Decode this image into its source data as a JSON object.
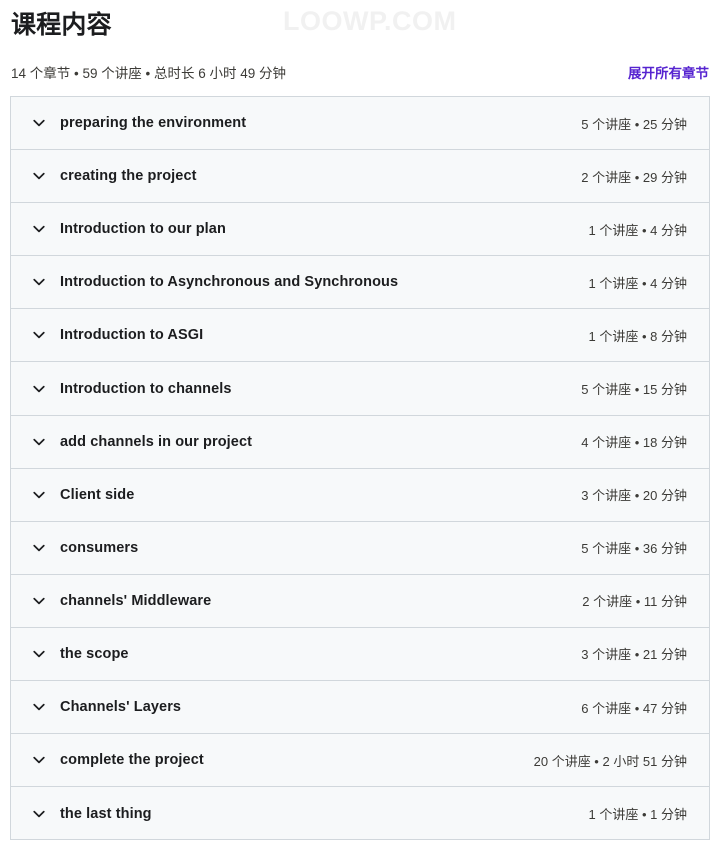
{
  "watermark": {
    "text": "LOOWP.COM"
  },
  "header": {
    "title": "课程内容",
    "summary": "14 个章节 • 59 个讲座 • 总时长 6 小时 49 分钟",
    "expand_all_label": "展开所有章节",
    "link_color": "#5624d0"
  },
  "colors": {
    "row_background": "#f7f9fa",
    "border": "#d1d7dc",
    "text_primary": "#1c1d1f",
    "text_secondary": "#3c3b37",
    "accent": "#5624d0",
    "watermark": "#f1f1f1"
  },
  "icons": {
    "chevron": "chevron-down-icon"
  },
  "sections": [
    {
      "title": "preparing the environment",
      "meta": "5 个讲座 • 25 分钟"
    },
    {
      "title": "creating the project",
      "meta": "2 个讲座 • 29 分钟"
    },
    {
      "title": "Introduction to our plan",
      "meta": "1 个讲座 • 4 分钟"
    },
    {
      "title": "Introduction to Asynchronous and Synchronous",
      "meta": "1 个讲座 • 4 分钟"
    },
    {
      "title": "Introduction to ASGI",
      "meta": "1 个讲座 • 8 分钟"
    },
    {
      "title": "Introduction to channels",
      "meta": "5 个讲座 • 15 分钟"
    },
    {
      "title": "add channels in our project",
      "meta": "4 个讲座 • 18 分钟"
    },
    {
      "title": "Client side",
      "meta": "3 个讲座 • 20 分钟"
    },
    {
      "title": "consumers",
      "meta": "5 个讲座 • 36 分钟"
    },
    {
      "title": "channels' Middleware",
      "meta": "2 个讲座 • 11 分钟"
    },
    {
      "title": "the scope",
      "meta": "3 个讲座 • 21 分钟"
    },
    {
      "title": "Channels' Layers",
      "meta": "6 个讲座 • 47 分钟"
    },
    {
      "title": "complete the project",
      "meta": "20 个讲座 • 2 小时 51 分钟"
    },
    {
      "title": "the last thing",
      "meta": "1 个讲座 • 1 分钟"
    }
  ]
}
